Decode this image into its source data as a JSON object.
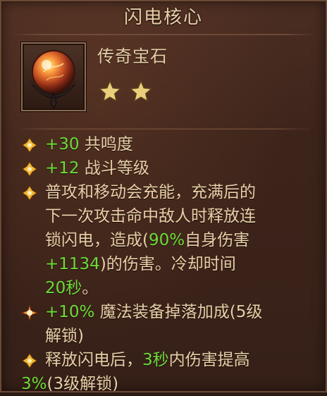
{
  "panel": {
    "title": "闪电核心",
    "type_label": "传奇宝石",
    "star_count": 2
  },
  "icon": {
    "name": "gem-orb-icon"
  },
  "stats": [
    {
      "value": "+30",
      "label": "共鸣度"
    },
    {
      "value": "+12",
      "label": "战斗等级"
    }
  ],
  "effects": {
    "e1_line1": "普攻和移动会充能，充满后的",
    "e1_line2": "下一次攻击命中敌人时释放连",
    "e1_line3_a": "锁闪电，造成(",
    "e1_line3_b": "90%",
    "e1_line3_c": "自身伤害",
    "e1_line4_a": "+1134",
    "e1_line4_b": ")的伤害。冷却时间",
    "e1_line5_a": "20秒",
    "e1_line5_b": "。",
    "e2_value": "+10%",
    "e2_line1": "魔法装备掉落加成(5级",
    "e2_line2": "解锁)",
    "e3_line1_a": "释放闪电后，",
    "e3_line1_b": "3秒",
    "e3_line1_c": "内伤害提高",
    "e3_line2_a": "3%",
    "e3_line2_b": "(3级解锁)"
  },
  "colors": {
    "highlight_green": "#6ddb3a",
    "text_cream": "#e8cfa8",
    "bullet_gold": "#f2b736",
    "star_gold": "#e9cf7a"
  }
}
